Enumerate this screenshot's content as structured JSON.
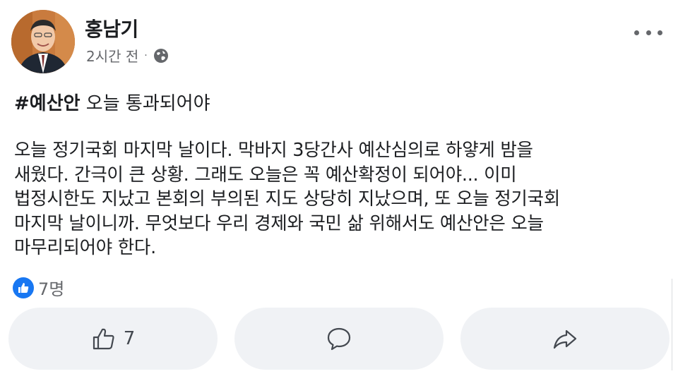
{
  "post": {
    "author": "홍남기",
    "timestamp": "2시간 전",
    "audience_icon": "globe-icon",
    "title_hashtag": "#예산안",
    "title_rest": " 오늘 통과되어야",
    "body_lines": [
      "오늘 정기국회 마지막 날이다. 막바지 3당간사 예산심의로 하얗게 밤을",
      "새웠다. 간극이 큰 상황. 그래도 오늘은 꼭 예산확정이 되어야... 이미",
      "법정시한도 지났고 본회의 부의된 지도 상당히 지났으며, 또 오늘 정기국회",
      "마지막 날이니까. 무엇보다 우리 경제와 국민 삶 위해서도 예산안은 오늘",
      "마무리되어야 한다."
    ]
  },
  "reactions": {
    "icon": "like-icon",
    "count_label": "7명"
  },
  "actions": {
    "like_count": "7"
  },
  "colors": {
    "like_blue": "#1877f2",
    "button_bg": "#f0f2f5",
    "secondary_text": "#65676b"
  }
}
